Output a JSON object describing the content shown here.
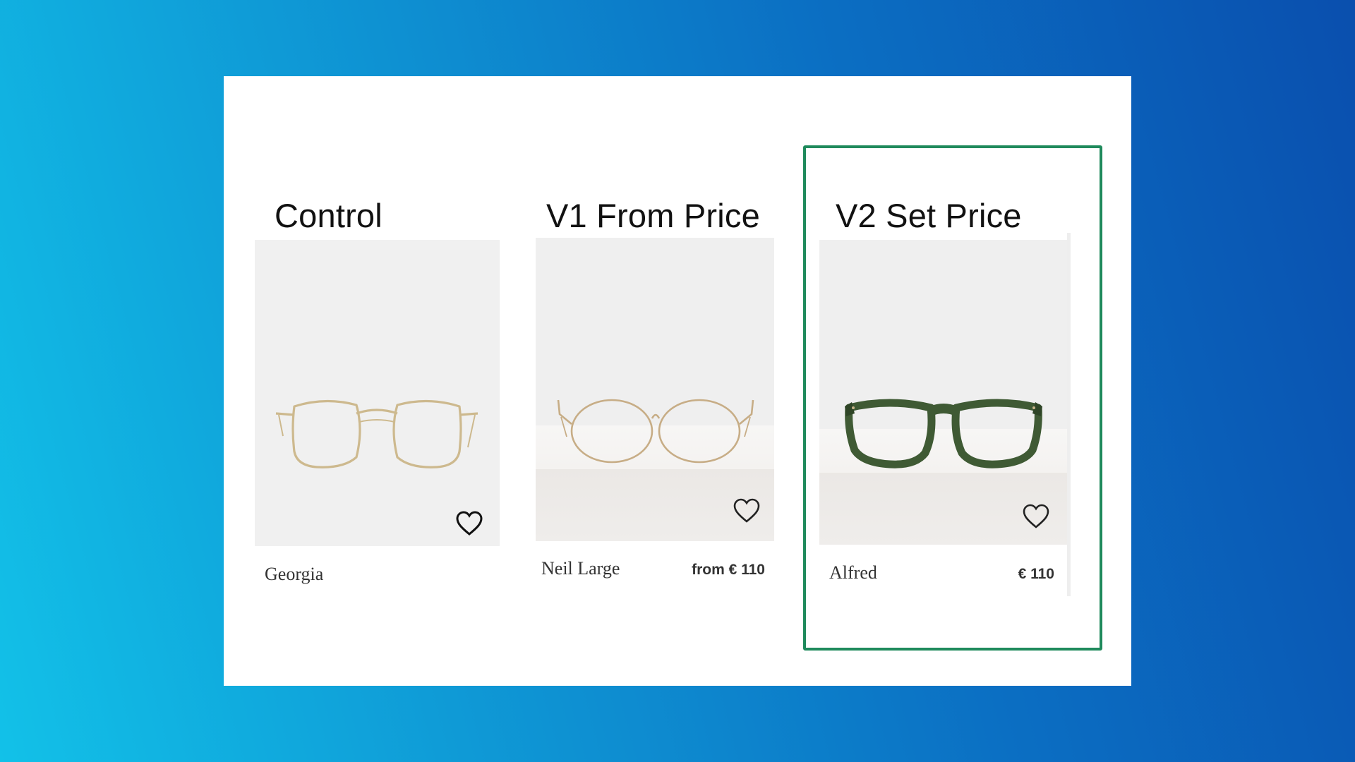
{
  "variants": [
    {
      "title": "Control",
      "product_name": "Georgia",
      "price": "",
      "frame_style": "thin gold square metal frame",
      "favorite_icon": "heart-outline-icon"
    },
    {
      "title": "V1 From Price",
      "product_name": "Neil Large",
      "price": "from € 110",
      "frame_style": "thin gold round metal frame",
      "favorite_icon": "heart-outline-icon"
    },
    {
      "title": "V2 Set Price",
      "product_name": "Alfred",
      "price": "€ 110",
      "frame_style": "thick green acetate frame",
      "favorite_icon": "heart-outline-icon",
      "highlighted": true
    }
  ],
  "colors": {
    "background_start": "#12c1e8",
    "background_end": "#0a4fae",
    "highlight_border": "#1f8a5c",
    "text": "#333333",
    "gold_frame": "#c9b48a",
    "green_frame": "#3f5a34"
  }
}
